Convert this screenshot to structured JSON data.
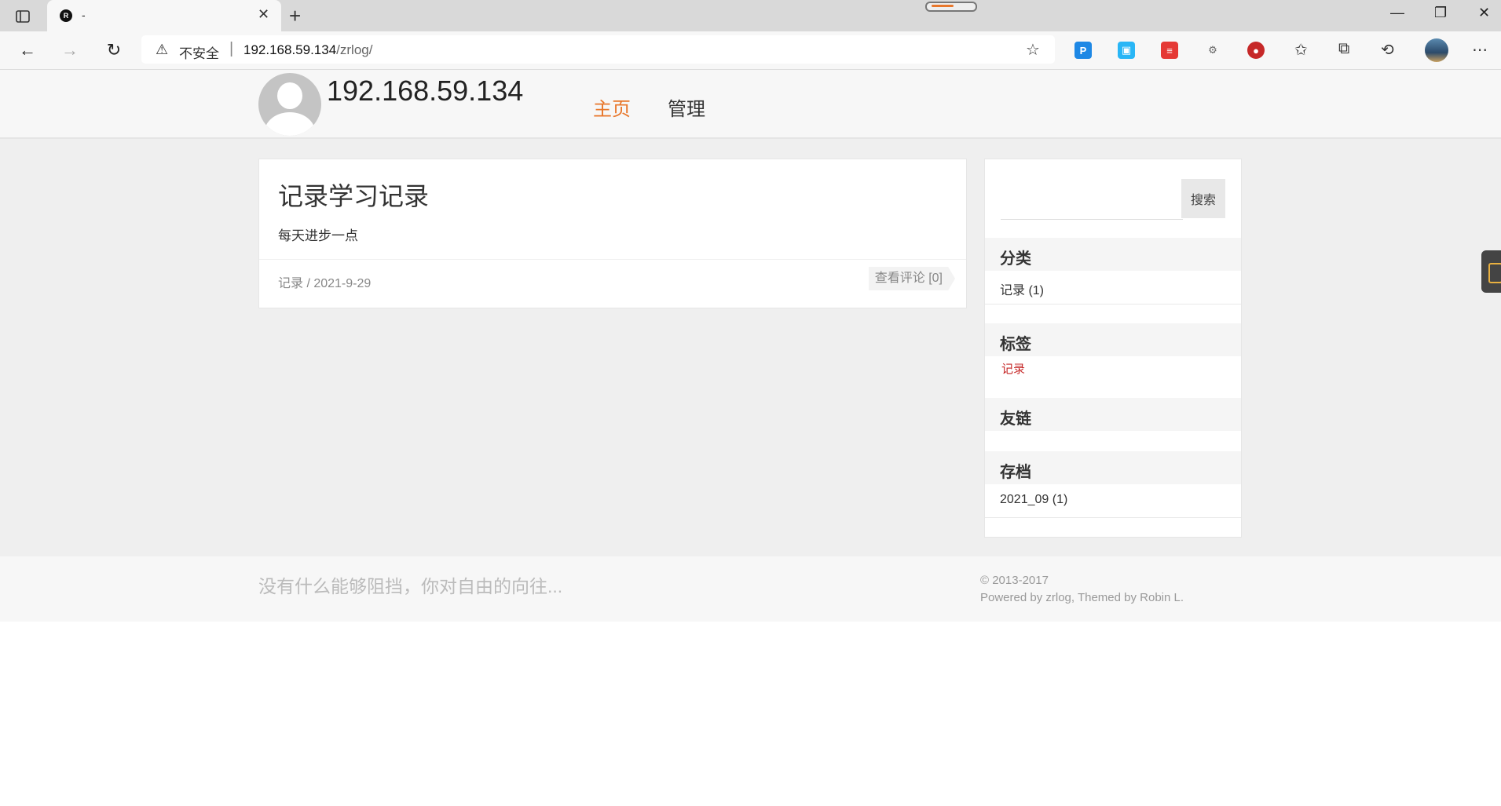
{
  "browser": {
    "tab_title": "-",
    "tab_favicon_letter": "R",
    "address_security": "不安全",
    "address_separator": "|",
    "address_host": "192.168.59.134",
    "address_path": "/zrlog/"
  },
  "site": {
    "title": "192.168.59.134",
    "nav": {
      "home": "主页",
      "admin": "管理"
    }
  },
  "post": {
    "title": "记录学习记录",
    "excerpt": "每天进步一点",
    "meta": "记录 / 2021-9-29",
    "comments_link": "查看评论 [0]"
  },
  "sidebar": {
    "search_placeholder": "",
    "search_button": "搜索",
    "categories_title": "分类",
    "category_item": "记录 (1)",
    "tags_title": "标签",
    "tag_item": "记录",
    "links_title": "友链",
    "archive_title": "存档",
    "archive_item": "2021_09 (1)"
  },
  "footer": {
    "motto": "没有什么能够阻挡，你对自由的向往...",
    "copyright": "© 2013-2017",
    "powered": "Powered by zrlog, Themed by Robin L."
  },
  "colors": {
    "accent": "#e8772b",
    "tag": "#c62828",
    "background": "#efefef"
  }
}
